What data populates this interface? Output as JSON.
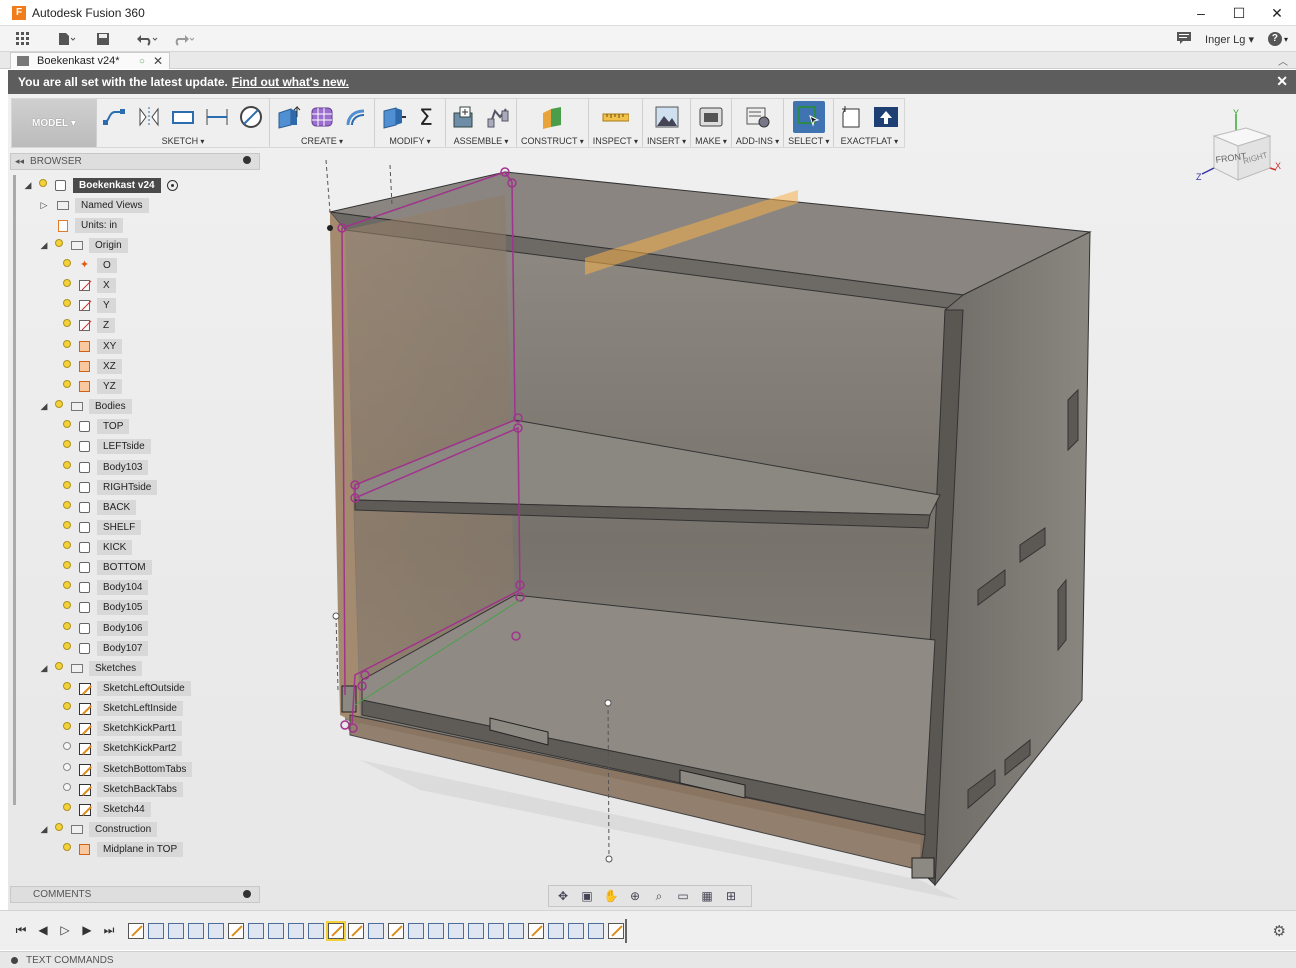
{
  "window": {
    "title": "Autodesk Fusion 360",
    "logo_letter": "F",
    "controls": {
      "minimize": "–",
      "maximize": "☐",
      "close": "✕"
    }
  },
  "quickbar": {
    "user": "Inger Lg",
    "help": "?"
  },
  "document_tab": {
    "name": "Boekenkast v24*"
  },
  "banner": {
    "message": "You are all set with the latest update.",
    "link": "Find out what's new."
  },
  "toolbar": {
    "workspace": "MODEL",
    "groups": [
      {
        "label": "SKETCH"
      },
      {
        "label": "CREATE"
      },
      {
        "label": "MODIFY"
      },
      {
        "label": "ASSEMBLE"
      },
      {
        "label": "CONSTRUCT"
      },
      {
        "label": "INSPECT"
      },
      {
        "label": "INSERT"
      },
      {
        "label": "MAKE"
      },
      {
        "label": "ADD-INS"
      },
      {
        "label": "SELECT"
      },
      {
        "label": "EXACTFLAT"
      }
    ]
  },
  "browser": {
    "title": "BROWSER",
    "root": "Boekenkast v24",
    "items": [
      {
        "label": "Named Views"
      },
      {
        "label": "Units: in"
      },
      {
        "label": "Origin"
      },
      {
        "label": "O"
      },
      {
        "label": "X"
      },
      {
        "label": "Y"
      },
      {
        "label": "Z"
      },
      {
        "label": "XY"
      },
      {
        "label": "XZ"
      },
      {
        "label": "YZ"
      },
      {
        "label": "Bodies"
      },
      {
        "label": "TOP"
      },
      {
        "label": "LEFTside"
      },
      {
        "label": "Body103"
      },
      {
        "label": "RIGHTside"
      },
      {
        "label": "BACK"
      },
      {
        "label": "SHELF"
      },
      {
        "label": "KICK"
      },
      {
        "label": "BOTTOM"
      },
      {
        "label": "Body104"
      },
      {
        "label": "Body105"
      },
      {
        "label": "Body106"
      },
      {
        "label": "Body107"
      },
      {
        "label": "Sketches"
      },
      {
        "label": "SketchLeftOutside"
      },
      {
        "label": "SketchLeftInside"
      },
      {
        "label": "SketchKickPart1"
      },
      {
        "label": "SketchKickPart2"
      },
      {
        "label": "SketchBottomTabs"
      },
      {
        "label": "SketchBackTabs"
      },
      {
        "label": "Sketch44"
      },
      {
        "label": "Construction"
      },
      {
        "label": "Midplane in TOP"
      }
    ]
  },
  "comments": {
    "title": "COMMENTS"
  },
  "viewcube": {
    "front": "FRONT",
    "right": "RIGHT",
    "x": "X",
    "y": "Y",
    "z": "Z"
  },
  "textcommands": {
    "label": "TEXT COMMANDS"
  },
  "colors": {
    "banner": "#5d5d5d",
    "body_gray": "#7b7770",
    "sketch_magenta": "#a0348c",
    "plane_orange": "#f5b14a",
    "active_blue": "#3f73b2"
  },
  "icons": [
    "grid-apps-icon",
    "file-icon",
    "save-icon",
    "undo-icon",
    "redo-icon",
    "comment-icon",
    "help-icon",
    "settings-icon",
    "pan-icon",
    "orbit-icon",
    "zoom-icon",
    "display-settings-icon",
    "grid-icon",
    "viewports-icon"
  ]
}
